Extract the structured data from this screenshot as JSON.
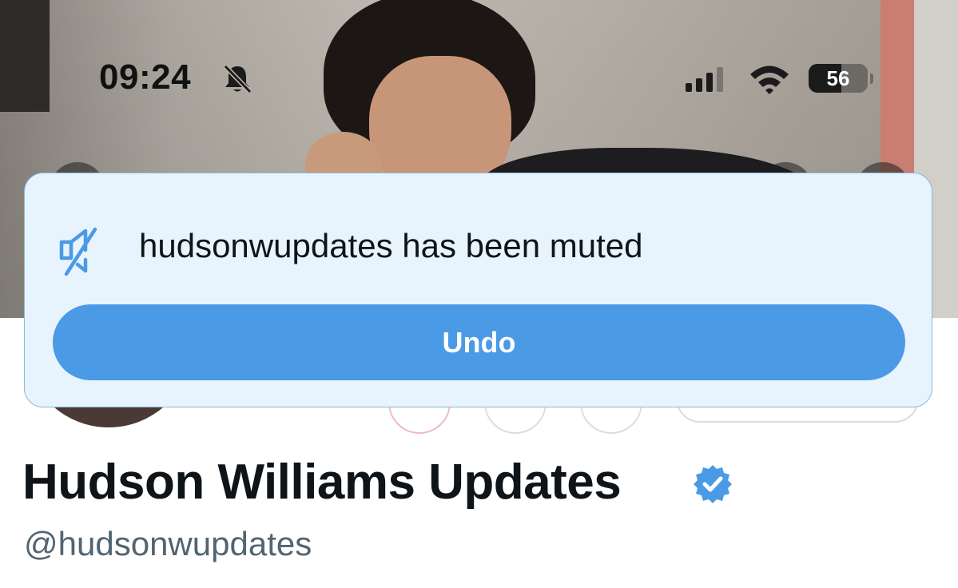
{
  "status_bar": {
    "time": "09:24",
    "battery_percent": "56",
    "battery_level": 0.56,
    "icons": [
      "bell-slash-icon",
      "cellular-signal-icon",
      "wifi-icon",
      "battery-icon"
    ]
  },
  "toast": {
    "icon": "mute-icon",
    "message": "hudsonwupdates has been muted",
    "undo_label": "Undo"
  },
  "profile": {
    "display_name": "Hudson Williams Updates",
    "verified": true,
    "verified_icon": "verified-badge-icon",
    "handle": "@hudsonwupdates"
  },
  "colors": {
    "accent": "#4a9ae6",
    "toast_bg": "#e8f4fd",
    "text_primary": "#0f1419",
    "text_secondary": "#536471",
    "verified": "#4a9ae6"
  }
}
